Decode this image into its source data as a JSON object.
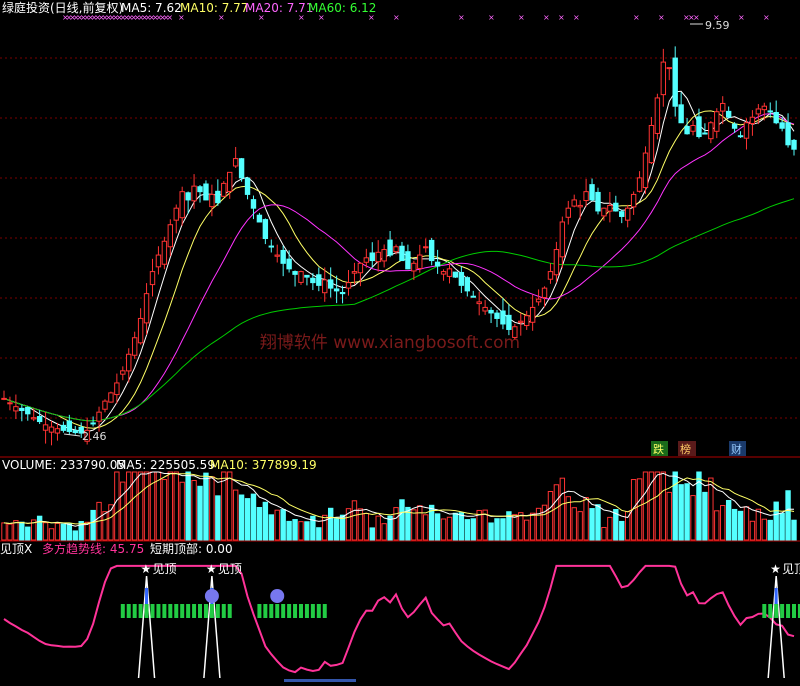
{
  "header": {
    "title": "绿庭投资(日线,前复权)",
    "ma5_label": "MA5: 7.62",
    "ma10_label": "MA10: 7.77",
    "ma20_label": "MA20: 7.71",
    "ma60_label": "MA60: 6.12"
  },
  "colors": {
    "bg": "#000000",
    "up": "#ff3333",
    "down": "#54ffff",
    "ma5": "#ffffff",
    "ma10": "#ffff66",
    "ma20": "#ff33ff",
    "ma60": "#00cc00",
    "trend": "#ff3399",
    "label_magenta": "#ff66ff",
    "grid": "#7a0000"
  },
  "watermark": "翔博软件  www.xiangbosoft.com",
  "price_labels": {
    "high": "9.59",
    "low": "2.46"
  },
  "event_markers": {
    "die": "跌",
    "bang": "榜",
    "cai": "财"
  },
  "volume_header": {
    "volume_label": "VOLUME: 233790.05",
    "ma5_label": "MA5: 225505.59",
    "ma10_label": "MA10: 377899.19"
  },
  "indicator_header": {
    "name": "见顶X",
    "trend_label": "多方趋势线: 45.75",
    "short_top_label": "短期顶部: 0.00"
  },
  "top_signal_label": "见顶",
  "chart_data": [
    {
      "type": "candlestick",
      "title": "绿庭投资(日线,前复权)",
      "ylim": [
        2.2,
        10.0
      ],
      "annotations": [
        "9.59",
        "2.46"
      ],
      "series": [
        {
          "name": "MA5",
          "value": 7.62
        },
        {
          "name": "MA10",
          "value": 7.77
        },
        {
          "name": "MA20",
          "value": 7.71
        },
        {
          "name": "MA60",
          "value": 6.12
        }
      ],
      "close": [
        3.1,
        3.02,
        2.95,
        2.88,
        2.82,
        2.75,
        2.68,
        2.62,
        2.58,
        2.55,
        2.52,
        2.5,
        2.48,
        2.47,
        2.52,
        2.65,
        2.85,
        3.05,
        3.2,
        3.38,
        3.6,
        3.9,
        4.2,
        4.55,
        5.0,
        5.4,
        5.7,
        5.95,
        6.25,
        6.55,
        6.85,
        6.7,
        6.95,
        6.85,
        6.7,
        6.8,
        6.65,
        7.0,
        7.2,
        7.45,
        7.1,
        6.8,
        6.55,
        6.3,
        6.0,
        5.85,
        5.7,
        5.55,
        5.45,
        5.35,
        5.4,
        5.3,
        5.2,
        5.15,
        5.25,
        5.1,
        5.05,
        5.0,
        5.2,
        5.4,
        5.55,
        5.65,
        5.6,
        5.75,
        5.8,
        5.7,
        5.85,
        5.6,
        5.45,
        5.55,
        5.7,
        5.85,
        5.6,
        5.5,
        5.4,
        5.45,
        5.3,
        5.15,
        5.05,
        4.95,
        4.85,
        4.75,
        4.65,
        4.55,
        4.45,
        4.35,
        4.4,
        4.5,
        4.6,
        4.75,
        4.9,
        5.1,
        5.4,
        5.8,
        6.3,
        6.55,
        6.7,
        6.6,
        6.85,
        6.7,
        6.5,
        6.55,
        6.6,
        6.5,
        6.4,
        6.55,
        6.8,
        7.1,
        7.55,
        8.05,
        8.55,
        9.2,
        9.1,
        8.4,
        8.1,
        7.9,
        8.05,
        7.85,
        7.9,
        8.1,
        8.3,
        8.45,
        8.2,
        8.0,
        7.85,
        8.1,
        8.2,
        8.35,
        8.4,
        8.3,
        8.1,
        8.0,
        7.7,
        7.62
      ],
      "volume_scale": [
        0,
        600000
      ],
      "volume_ma": [
        {
          "name": "VOLUME",
          "value": 233790.05
        },
        {
          "name": "MA5",
          "value": 225505.59
        },
        {
          "name": "MA10",
          "value": 377899.19
        }
      ],
      "indicator": {
        "series": [
          {
            "name": "多方趋势线",
            "value": 45.75
          },
          {
            "name": "短期顶部",
            "value": 0.0
          }
        ]
      }
    }
  ]
}
